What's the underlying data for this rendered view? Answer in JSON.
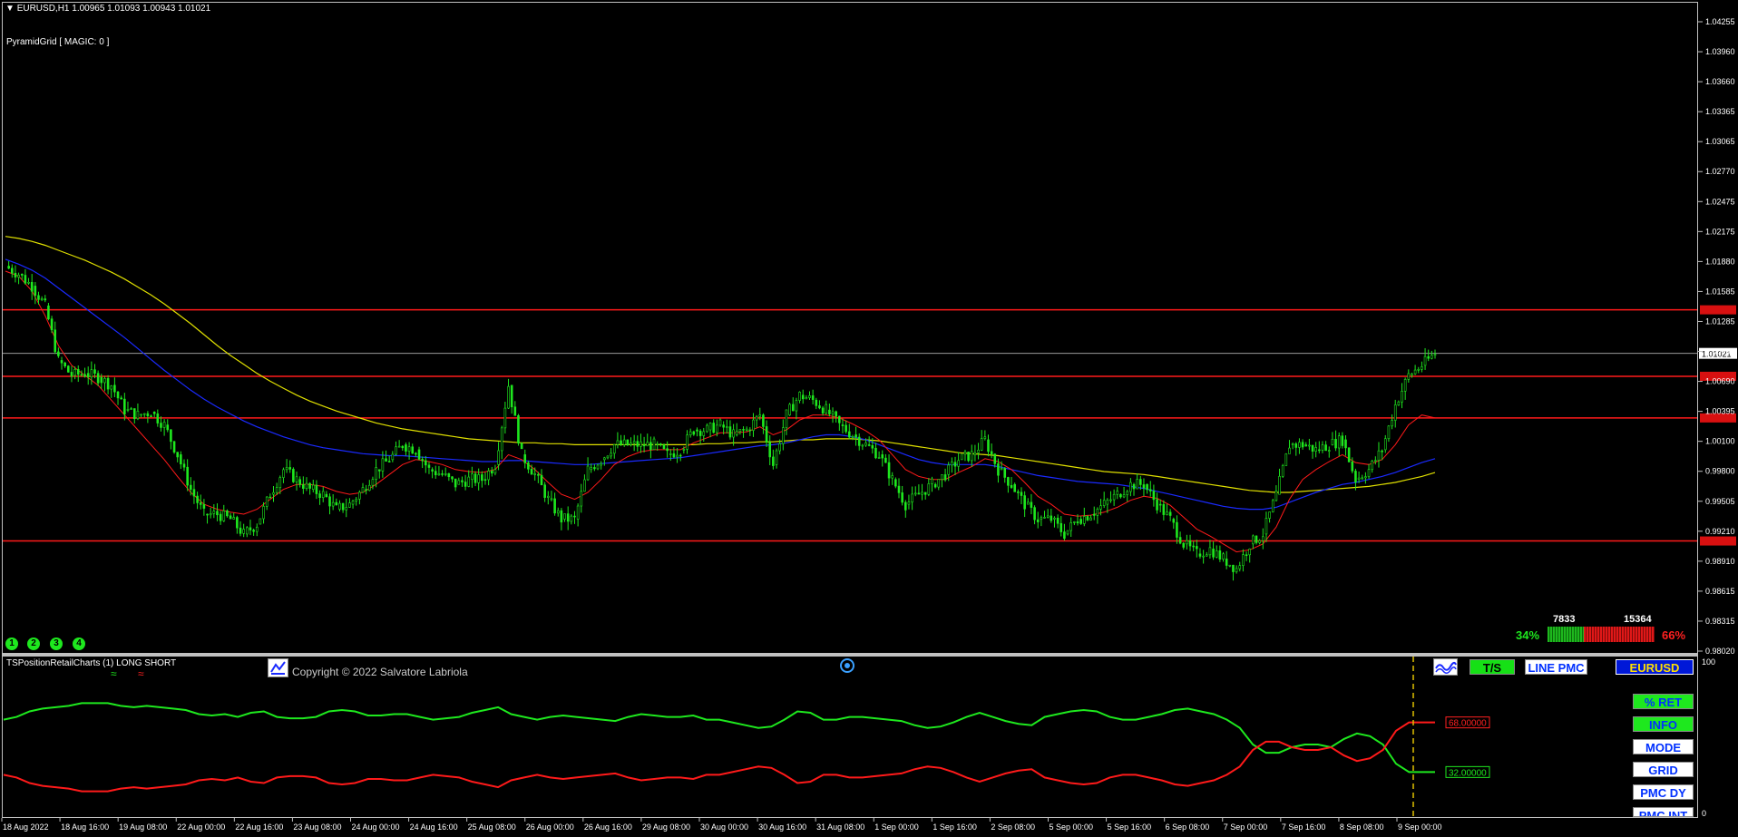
{
  "header": {
    "symbol_line": "EURUSD,H1  1.00965 1.01093 1.00943 1.01021",
    "ea_label": "PyramidGrid  [ MAGIC: 0 ]"
  },
  "chart_data": [
    {
      "type": "candlestick",
      "title": "EURUSD,H1",
      "ohlc_current": {
        "open": 1.00965,
        "high": 1.01093,
        "low": 1.00943,
        "close": 1.01021
      },
      "ylim": [
        0.9802,
        1.044
      ],
      "y_ticks": [
        "1.04255",
        "1.03960",
        "1.03660",
        "1.03365",
        "1.03065",
        "1.02770",
        "1.02475",
        "1.02175",
        "1.01880",
        "1.01585",
        "1.01285",
        "1.00990",
        "1.00690",
        "1.00395",
        "1.00100",
        "0.99800",
        "0.99505",
        "0.99210",
        "0.98910",
        "0.98615",
        "0.98315",
        "0.98020"
      ],
      "current_price_label": "1.01021",
      "hlines": [
        {
          "value": 1.0146,
          "color": "#ff1a1a"
        },
        {
          "value": 1.0079,
          "color": "#ff1a1a"
        },
        {
          "value": 1.0037,
          "color": "#ff1a1a"
        },
        {
          "value": 0.9913,
          "color": "#ff1a1a"
        }
      ],
      "close_series": [
        1.019,
        1.0182,
        1.017,
        1.015,
        1.0095,
        1.008,
        1.0082,
        1.0078,
        1.007,
        1.0045,
        1.004,
        1.0043,
        1.003,
        1.0,
        0.9965,
        0.994,
        0.994,
        0.9935,
        0.992,
        0.993,
        0.996,
        0.9985,
        0.9975,
        0.9965,
        0.996,
        0.9945,
        0.995,
        0.9965,
        0.9985,
        0.9995,
        1.001,
        1.0005,
        0.9985,
        0.998,
        0.997,
        0.9975,
        0.9975,
        0.999,
        1.007,
        1.0,
        0.998,
        0.9955,
        0.9935,
        0.9935,
        0.9985,
        0.9995,
        1.001,
        1.001,
        1.001,
        1.001,
        1.0,
        1.0005,
        1.0025,
        1.0025,
        1.003,
        1.002,
        1.0025,
        1.004,
        0.999,
        1.004,
        1.006,
        1.0055,
        1.0045,
        1.003,
        1.002,
        1.001,
        1.0,
        0.9975,
        0.995,
        0.996,
        0.997,
        0.998,
        0.9995,
        1.0,
        1.0015,
        0.9985,
        0.997,
        0.995,
        0.9935,
        0.9935,
        0.992,
        0.9935,
        0.994,
        0.995,
        0.996,
        0.997,
        0.997,
        0.995,
        0.9935,
        0.991,
        0.99,
        0.9905,
        0.9895,
        0.9885,
        0.991,
        0.992,
        0.996,
        1.001,
        1.001,
        1.0005,
        1.001,
        1.0015,
        0.9975,
        0.9985,
        1.0005,
        1.005,
        1.008,
        1.009,
        1.0102
      ],
      "ema_red": [
        1.0185,
        1.018,
        1.0165,
        1.014,
        1.011,
        1.009,
        1.008,
        1.007,
        1.0055,
        1.004,
        1.0025,
        1.001,
        0.9995,
        0.9978,
        0.9962,
        0.995,
        0.9945,
        0.9942,
        0.994,
        0.9945,
        0.9955,
        0.9965,
        0.997,
        0.997,
        0.9968,
        0.9963,
        0.996,
        0.9962,
        0.997,
        0.998,
        0.999,
        0.9995,
        0.9993,
        0.999,
        0.9985,
        0.9983,
        0.9982,
        0.9985,
        1.0,
        0.9995,
        0.9985,
        0.9972,
        0.996,
        0.9955,
        0.9962,
        0.9975,
        0.999,
        0.9998,
        1.0003,
        1.0005,
        1.0005,
        1.0005,
        1.0012,
        1.0017,
        1.0022,
        1.0022,
        1.0023,
        1.0028,
        1.002,
        1.0025,
        1.0035,
        1.004,
        1.004,
        1.0037,
        1.0031,
        1.0024,
        1.0015,
        1.0,
        0.9985,
        0.9978,
        0.9975,
        0.9975,
        0.9982,
        0.9988,
        0.9996,
        0.9993,
        0.9985,
        0.9972,
        0.9958,
        0.995,
        0.994,
        0.9938,
        0.9939,
        0.9942,
        0.9947,
        0.9954,
        0.9958,
        0.9956,
        0.9949,
        0.9937,
        0.9925,
        0.9918,
        0.991,
        0.9902,
        0.9904,
        0.991,
        0.9927,
        0.9955,
        0.9975,
        0.9985,
        0.9993,
        1.0,
        0.9992,
        0.999,
        0.9995,
        1.001,
        1.003,
        1.004,
        1.0037
      ],
      "ma_blue": [
        1.0197,
        1.0192,
        1.0186,
        1.0178,
        1.0168,
        1.0158,
        1.0148,
        1.0138,
        1.0128,
        1.0118,
        1.0107,
        1.0096,
        1.0085,
        1.0075,
        1.0065,
        1.0056,
        1.0048,
        1.0041,
        1.0034,
        1.0028,
        1.0023,
        1.0018,
        1.0014,
        1.001,
        1.0007,
        1.0005,
        1.0003,
        1.0001,
        1.0,
        0.9999,
        0.9999,
        0.9998,
        0.9997,
        0.9996,
        0.9995,
        0.9994,
        0.9993,
        0.9993,
        0.9994,
        0.9994,
        0.9993,
        0.9992,
        0.9991,
        0.999,
        0.999,
        0.9991,
        0.9992,
        0.9993,
        0.9994,
        0.9995,
        0.9996,
        0.9997,
        0.9999,
        1.0001,
        1.0003,
        1.0005,
        1.0007,
        1.0009,
        1.001,
        1.0012,
        1.0015,
        1.0018,
        1.002,
        1.002,
        1.0018,
        1.0015,
        1.001,
        1.0005,
        1.0,
        0.9995,
        0.9992,
        0.999,
        0.999,
        0.999,
        0.999,
        0.9988,
        0.9985,
        0.9982,
        0.9979,
        0.9977,
        0.9975,
        0.9973,
        0.9972,
        0.9971,
        0.997,
        0.9968,
        0.9966,
        0.9963,
        0.996,
        0.9957,
        0.9954,
        0.9951,
        0.9948,
        0.9946,
        0.9945,
        0.9945,
        0.9947,
        0.9952,
        0.9957,
        0.9962,
        0.9966,
        0.997,
        0.9972,
        0.9975,
        0.9978,
        0.9982,
        0.9987,
        0.9992,
        0.9996
      ],
      "ma_yellow": [
        1.022,
        1.0218,
        1.0215,
        1.0211,
        1.0206,
        1.0201,
        1.0196,
        1.019,
        1.0184,
        1.0177,
        1.0169,
        1.0161,
        1.0152,
        1.0142,
        1.0132,
        1.0121,
        1.011,
        1.01,
        1.0091,
        1.0082,
        1.0074,
        1.0067,
        1.006,
        1.0054,
        1.0049,
        1.0044,
        1.004,
        1.0036,
        1.0032,
        1.0029,
        1.0026,
        1.0024,
        1.0022,
        1.002,
        1.0018,
        1.0016,
        1.0015,
        1.0014,
        1.0013,
        1.0012,
        1.0012,
        1.0011,
        1.0011,
        1.001,
        1.001,
        1.001,
        1.001,
        1.001,
        1.001,
        1.001,
        1.001,
        1.001,
        1.001,
        1.0011,
        1.0011,
        1.0012,
        1.0012,
        1.0013,
        1.0013,
        1.0014,
        1.0015,
        1.0015,
        1.0016,
        1.0016,
        1.0016,
        1.0015,
        1.0014,
        1.0012,
        1.001,
        1.0008,
        1.0006,
        1.0004,
        1.0002,
        1.0001,
        1.0,
        0.9999,
        0.9997,
        0.9995,
        0.9993,
        0.9991,
        0.9989,
        0.9987,
        0.9985,
        0.9983,
        0.9982,
        0.9981,
        0.998,
        0.9978,
        0.9976,
        0.9974,
        0.9972,
        0.997,
        0.9968,
        0.9966,
        0.9964,
        0.9963,
        0.9962,
        0.9962,
        0.9963,
        0.9964,
        0.9965,
        0.9966,
        0.9967,
        0.9968,
        0.997,
        0.9972,
        0.9975,
        0.9978,
        0.9982
      ],
      "x_tick_labels": [
        "18 Aug 2022",
        "18 Aug 16:00",
        "19 Aug 08:00",
        "22 Aug 00:00",
        "22 Aug 16:00",
        "23 Aug 08:00",
        "24 Aug 00:00",
        "24 Aug 16:00",
        "25 Aug 08:00",
        "26 Aug 00:00",
        "26 Aug 16:00",
        "29 Aug 08:00",
        "30 Aug 00:00",
        "30 Aug 16:00",
        "31 Aug 08:00",
        "1 Sep 00:00",
        "1 Sep 16:00",
        "2 Sep 08:00",
        "5 Sep 00:00",
        "5 Sep 16:00",
        "6 Sep 08:00",
        "7 Sep 00:00",
        "7 Sep 16:00",
        "8 Sep 08:00",
        "9 Sep 00:00"
      ]
    },
    {
      "type": "line",
      "title": "TSPositionRetailCharts (1) LONG SHORT",
      "ylim": [
        0,
        100
      ],
      "y_ticks": [
        "100",
        "0"
      ],
      "series": [
        {
          "name": "LONG",
          "color": "#1ee81e",
          "values": [
            70,
            72,
            76,
            78,
            79,
            80,
            82,
            82,
            82,
            80,
            79,
            80,
            79,
            78,
            77,
            74,
            73,
            74,
            72,
            75,
            76,
            72,
            71,
            71,
            72,
            76,
            77,
            76,
            73,
            73,
            74,
            74,
            72,
            70,
            71,
            72,
            75,
            77,
            79,
            74,
            72,
            70,
            72,
            73,
            72,
            71,
            70,
            69,
            72,
            74,
            73,
            72,
            72,
            73,
            70,
            70,
            68,
            66,
            64,
            65,
            70,
            76,
            75,
            70,
            70,
            72,
            72,
            71,
            70,
            69,
            66,
            64,
            65,
            68,
            72,
            75,
            72,
            69,
            67,
            66,
            72,
            74,
            76,
            77,
            76,
            72,
            70,
            70,
            72,
            74,
            77,
            78,
            76,
            74,
            70,
            64,
            52,
            46,
            46,
            50,
            52,
            52,
            50,
            56,
            60,
            58,
            52,
            38,
            32,
            32,
            32
          ]
        },
        {
          "name": "SHORT",
          "color": "#ff1a1a",
          "values": [
            30,
            28,
            24,
            22,
            21,
            20,
            18,
            18,
            18,
            20,
            21,
            20,
            21,
            22,
            23,
            26,
            27,
            26,
            28,
            25,
            24,
            28,
            29,
            29,
            28,
            24,
            23,
            24,
            27,
            27,
            26,
            26,
            28,
            30,
            29,
            28,
            25,
            23,
            21,
            26,
            28,
            30,
            28,
            27,
            28,
            29,
            30,
            31,
            28,
            26,
            27,
            28,
            28,
            27,
            30,
            30,
            32,
            34,
            36,
            35,
            30,
            24,
            25,
            30,
            30,
            28,
            28,
            29,
            30,
            31,
            34,
            36,
            35,
            32,
            28,
            25,
            28,
            31,
            33,
            34,
            28,
            26,
            24,
            23,
            24,
            28,
            30,
            30,
            28,
            26,
            23,
            22,
            24,
            26,
            30,
            36,
            48,
            54,
            54,
            50,
            48,
            48,
            50,
            44,
            40,
            42,
            48,
            62,
            68,
            68,
            68
          ]
        }
      ],
      "value_labels": [
        "68.00000",
        "32.00000"
      ]
    }
  ],
  "sentiment": {
    "long_count": "7833",
    "short_count": "15364",
    "long_pct": "34%",
    "short_pct": "66%"
  },
  "markers": {
    "m1": "1",
    "m2": "2",
    "m3": "3",
    "m4": "4"
  },
  "sub_window": {
    "title": "TSPositionRetailCharts (1) LONG SHORT",
    "copyright": "Copyright © 2022 Salvatore Labriola"
  },
  "buttons": {
    "ts": "T/S",
    "line_pmc": "LINE PMC",
    "symbol": "EURUSD",
    "pct_ret": "% RET",
    "info": "INFO",
    "mode": "MODE",
    "grid": "GRID",
    "pmc_dy": "PMC DY",
    "pmc_int": "PMC INT"
  },
  "colors": {
    "candle": "#1ee81e",
    "level_line": "#ff1a1a",
    "ema": "#ff1a1a",
    "ma_blue": "#1a2aff",
    "ma_yellow": "#e0e000",
    "grid_border": "#c0c0c0"
  }
}
